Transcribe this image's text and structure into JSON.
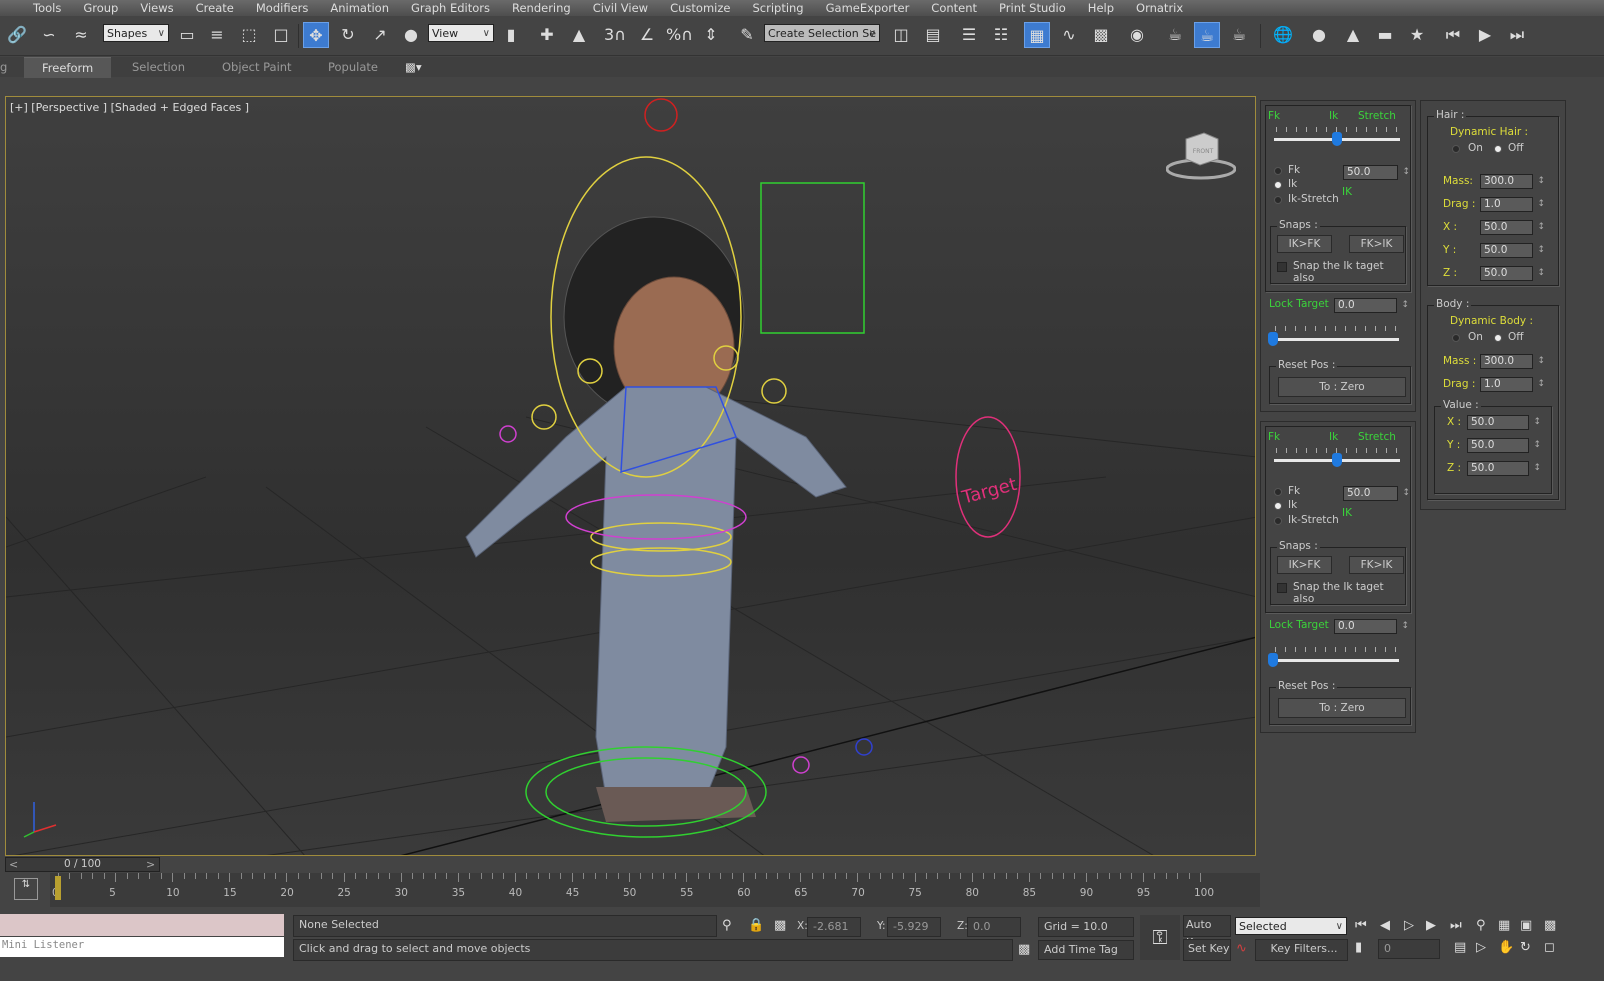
{
  "menu": [
    "Tools",
    "Group",
    "Views",
    "Create",
    "Modifiers",
    "Animation",
    "Graph Editors",
    "Rendering",
    "Civil View",
    "Customize",
    "Scripting",
    "GameExporter",
    "Content",
    "Print Studio",
    "Help",
    "Ornatrix"
  ],
  "toolbar": {
    "selection_filter": "Shapes",
    "reference_coord": "View",
    "named_selection": "Create Selection Se",
    "snap_labels": {
      "snap3": "3",
      "percent": "%"
    }
  },
  "ribbon": {
    "partial": "g",
    "tabs": [
      "Freeform",
      "Selection",
      "Object Paint",
      "Populate"
    ],
    "active": "Freeform"
  },
  "viewport": {
    "label": "[+] [Perspective ] [Shaded + Edged Faces ]",
    "target_label": "Target",
    "viewcube_label": "FRONT"
  },
  "rig_panels": [
    {
      "fk": "Fk",
      "ik": "Ik",
      "stretch": "Stretch",
      "modes": [
        "Fk",
        "Ik",
        "Ik-Stretch"
      ],
      "selected_mode": "Ik",
      "blend_value": "50.0",
      "blend_fraction": 0.5,
      "mode_indicator": "IK",
      "snaps_title": "Snaps :",
      "ik_fk": "IK>FK",
      "fk_ik": "FK>IK",
      "snap_check": "Snap the Ik taget also",
      "lock_target": "Lock Target",
      "lock_value": "0.0",
      "lock_fraction": 0.0,
      "reset_title": "Reset Pos :",
      "reset_button": "To : Zero"
    },
    {
      "fk": "Fk",
      "ik": "Ik",
      "stretch": "Stretch",
      "modes": [
        "Fk",
        "Ik",
        "Ik-Stretch"
      ],
      "selected_mode": "Ik",
      "blend_value": "50.0",
      "blend_fraction": 0.5,
      "mode_indicator": "IK",
      "snaps_title": "Snaps :",
      "ik_fk": "IK>FK",
      "fk_ik": "FK>IK",
      "snap_check": "Snap the Ik taget also",
      "lock_target": "Lock Target",
      "lock_value": "0.0",
      "lock_fraction": 0.0,
      "reset_title": "Reset Pos :",
      "reset_button": "To : Zero"
    }
  ],
  "dynamics": {
    "hair": {
      "title": "Hair :",
      "dynamic": "Dynamic Hair :",
      "on": "On",
      "off": "Off",
      "selected": "Off",
      "mass_label": "Mass:",
      "mass": "300.0",
      "drag_label": "Drag :",
      "drag": "1.0",
      "x_label": "X :",
      "x": "50.0",
      "y_label": "Y :",
      "y": "50.0",
      "z_label": "Z :",
      "z": "50.0"
    },
    "body": {
      "title": "Body :",
      "dynamic": "Dynamic Body :",
      "on": "On",
      "off": "Off",
      "selected": "Off",
      "mass_label": "Mass :",
      "mass": "300.0",
      "drag_label": "Drag :",
      "drag": "1.0",
      "value_title": "Value :",
      "x_label": "X :",
      "x": "50.0",
      "y_label": "Y :",
      "y": "50.0",
      "z_label": "Z :",
      "z": "50.0"
    }
  },
  "timeline": {
    "frame": "0 / 100",
    "prev": "<",
    "next": ">",
    "labels": [
      "0",
      "5",
      "10",
      "15",
      "20",
      "25",
      "30",
      "35",
      "40",
      "45",
      "50",
      "55",
      "60",
      "65",
      "70",
      "75",
      "80",
      "85",
      "90",
      "95",
      "100"
    ],
    "current_frame": 0
  },
  "status": {
    "listener_label": "Mini Listener",
    "selection": "None Selected",
    "prompt": "Click and drag to select and move objects",
    "x_label": "X:",
    "x": "-2.681",
    "y_label": "Y:",
    "y": "-5.929",
    "z_label": "Z:",
    "z": "0.0",
    "grid": "Grid = 10.0",
    "add_time_tag": "Add Time Tag",
    "auto_key": "Auto Key",
    "set_key": "Set Key",
    "key_mode": "Selected",
    "key_filters": "Key Filters...",
    "frame_input": "0"
  },
  "colors": {
    "accent": "#3d7bd0",
    "green_label": "#3bd43b",
    "yellow_label": "#dede3a",
    "viewport_border": "#a08c3c"
  }
}
